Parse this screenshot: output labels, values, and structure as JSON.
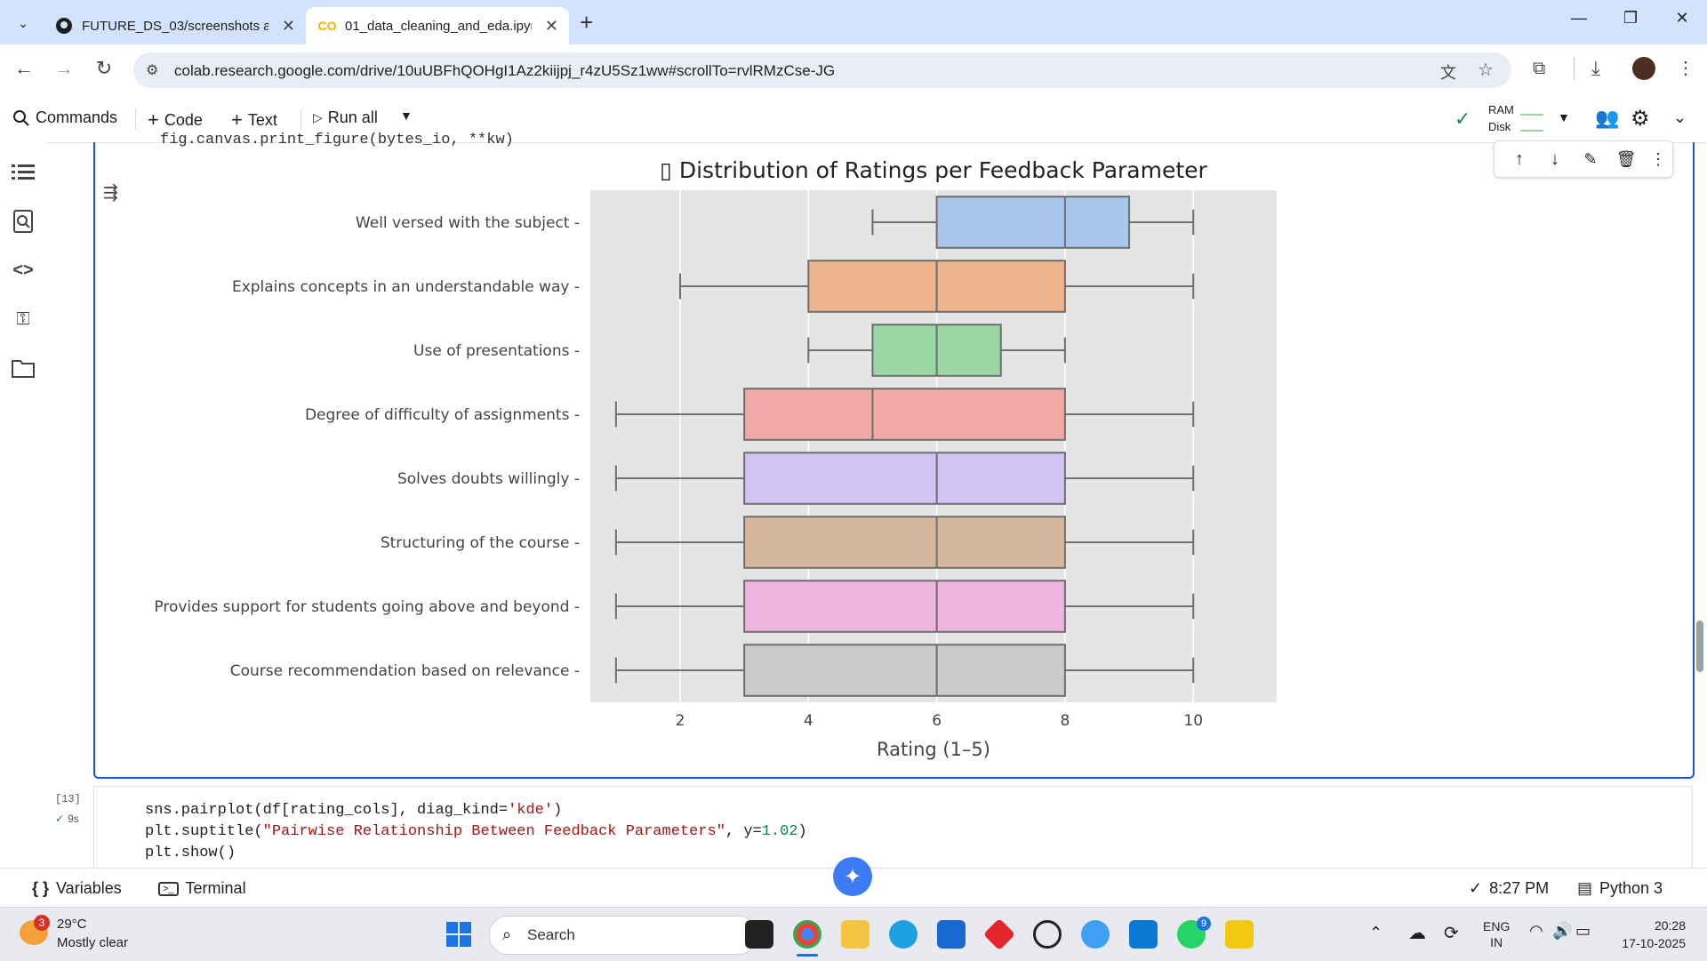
{
  "browser": {
    "tabs": [
      {
        "title": "FUTURE_DS_03/screenshots at",
        "active": false
      },
      {
        "title": "01_data_cleaning_and_eda.ipyn",
        "active": true
      }
    ],
    "url": "colab.research.google.com/drive/10uUBFhQOHgI1Az2kiijpj_r4zU5Sz1ww#scrollTo=rvlRMzCse-JG"
  },
  "toolbar": {
    "commands": "Commands",
    "code": "Code",
    "text": "Text",
    "run_all": "Run all",
    "ram": "RAM",
    "disk": "Disk"
  },
  "cell_output": {
    "clipped_code": "fig.canvas.print_figure(bytes_io, **kw)"
  },
  "chart_data": {
    "type": "boxplot",
    "title": "▯ Distribution of Ratings per Feedback Parameter",
    "xlabel": "Rating (1–5)",
    "ylabel": "",
    "xlim": [
      0.6,
      11.3
    ],
    "xticks": [
      2,
      4,
      6,
      8,
      10
    ],
    "grid": true,
    "orientation": "horizontal",
    "series": [
      {
        "label": "Well versed with the subject",
        "min": 5,
        "q1": 6,
        "median": 8,
        "q3": 9,
        "max": 10,
        "color": "#a7c7ec"
      },
      {
        "label": "Explains concepts in an understandable way",
        "min": 2,
        "q1": 4,
        "median": 6,
        "q3": 8,
        "max": 10,
        "color": "#efb58d"
      },
      {
        "label": "Use of presentations",
        "min": 4,
        "q1": 5,
        "median": 6,
        "q3": 7,
        "max": 8,
        "color": "#9ad7a5"
      },
      {
        "label": "Degree of difficulty of assignments",
        "min": 1,
        "q1": 3,
        "median": 5,
        "q3": 8,
        "max": 10,
        "color": "#f1a9a6"
      },
      {
        "label": "Solves doubts willingly",
        "min": 1,
        "q1": 3,
        "median": 6,
        "q3": 8,
        "max": 10,
        "color": "#d2c3f5"
      },
      {
        "label": "Structuring of the course",
        "min": 1,
        "q1": 3,
        "median": 6,
        "q3": 8,
        "max": 10,
        "color": "#d5b89c"
      },
      {
        "label": "Provides support for students going above and beyond",
        "min": 1,
        "q1": 3,
        "median": 6,
        "q3": 8,
        "max": 10,
        "color": "#efb6df"
      },
      {
        "label": "Course recommendation based on relevance",
        "min": 1,
        "q1": 3,
        "median": 6,
        "q3": 8,
        "max": 10,
        "color": "#cccccc"
      }
    ]
  },
  "cell13": {
    "exec_count": "[13]",
    "exec_time": "9s",
    "lines": [
      {
        "a": "sns.pairplot(df[rating_cols], diag_kind=",
        "s": "'kde'",
        "b": ")"
      },
      {
        "a": "plt.suptitle(",
        "s": "\"Pairwise Relationship Between Feedback Parameters\"",
        "b": ", y=",
        "n": "1.02",
        "c": ")"
      },
      {
        "a": "plt.show()",
        "s": "",
        "b": ""
      }
    ]
  },
  "statusbar": {
    "variables": "Variables",
    "terminal": "Terminal",
    "time": "8:27 PM",
    "runtime": "Python 3"
  },
  "taskbar": {
    "weather_temp": "29°C",
    "weather_desc": "Mostly clear",
    "weather_badge": "3",
    "search_label": "Search",
    "lang": "ENG",
    "region": "IN",
    "clock_time": "20:28",
    "clock_date": "17-10-2025",
    "whatsapp_badge": "9"
  }
}
